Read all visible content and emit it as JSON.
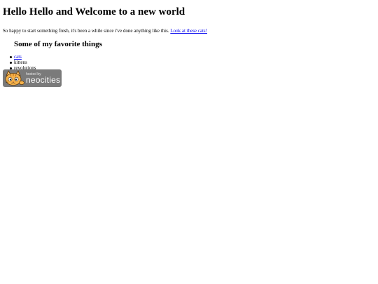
{
  "page": {
    "title": "Hello Hello and Welcome to a new world",
    "intro_text": "So happy to start something fresh, it's been a while since i've done anything like this. ",
    "intro_link": "Look at these cats!"
  },
  "favorites": {
    "heading": "Some of my favorite things",
    "items": [
      {
        "label": "cats",
        "is_link": true
      },
      {
        "label": "kittens",
        "is_link": false
      },
      {
        "label": "revolutions",
        "is_link": false
      }
    ]
  },
  "badge": {
    "line1": "hosted by",
    "line2": "neocities",
    "icon": "neocities-cat-icon",
    "background": "#7a7a7a"
  },
  "colors": {
    "link": "#0000ee",
    "text": "#000000",
    "background": "#ffffff"
  }
}
